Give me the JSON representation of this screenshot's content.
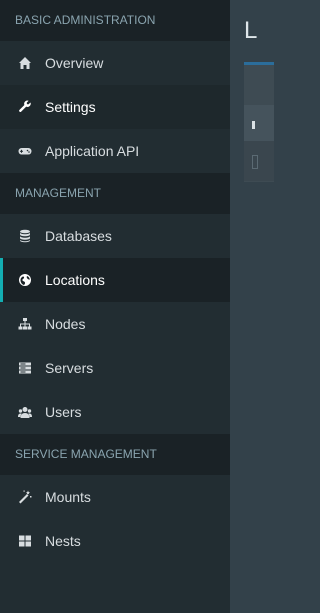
{
  "sidebar": {
    "sections": [
      {
        "header": "BASIC ADMINISTRATION",
        "items": [
          {
            "label": "Overview",
            "icon": "home-icon"
          },
          {
            "label": "Settings",
            "icon": "wrench-icon"
          },
          {
            "label": "Application API",
            "icon": "gamepad-icon"
          }
        ]
      },
      {
        "header": "MANAGEMENT",
        "items": [
          {
            "label": "Databases",
            "icon": "database-icon"
          },
          {
            "label": "Locations",
            "icon": "globe-icon",
            "active": true
          },
          {
            "label": "Nodes",
            "icon": "sitemap-icon"
          },
          {
            "label": "Servers",
            "icon": "server-icon"
          },
          {
            "label": "Users",
            "icon": "users-icon"
          }
        ]
      },
      {
        "header": "SERVICE MANAGEMENT",
        "items": [
          {
            "label": "Mounts",
            "icon": "magic-wand-icon"
          },
          {
            "label": "Nests",
            "icon": "th-large-icon"
          }
        ]
      }
    ]
  },
  "content": {
    "title_partial": "L"
  },
  "colors": {
    "sidebar_bg": "#222d32",
    "header_bg": "#1a2226",
    "active_accent": "#13aeb2",
    "content_bg": "#33414a",
    "box_accent": "#2b6d9b"
  }
}
